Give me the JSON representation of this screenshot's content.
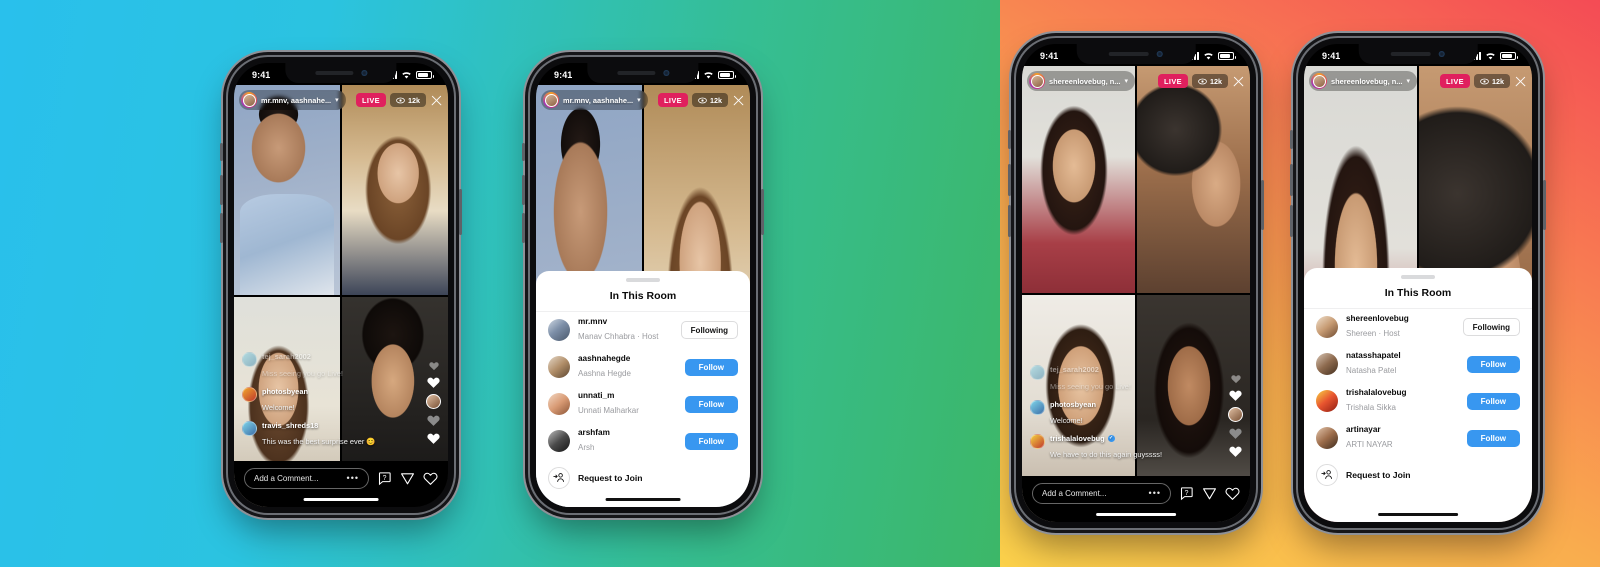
{
  "background": {
    "left_gradient": [
      "#29c0ec",
      "#3cb768"
    ],
    "right_gradient": [
      "#fbd14b",
      "#f44b55"
    ]
  },
  "status_bar": {
    "time": "9:41"
  },
  "phones": [
    {
      "id": "phone-1",
      "variant": "live-room-grid",
      "host_chip": {
        "names": "mr.mnv, aashnahe...",
        "avatar": "host-avatar"
      },
      "live_badge": "LIVE",
      "viewers": "12k",
      "close_label": "close-icon",
      "tiles": [
        "manav",
        "aashna",
        "girl1",
        "guy2"
      ],
      "comments": [
        {
          "user": "tej_sarah2002",
          "text": "Miss seeing you go Live!",
          "faded": true,
          "verified": false
        },
        {
          "user": "photosbyean",
          "text": "Welcome!",
          "faded": false,
          "verified": false
        },
        {
          "user": "travis_shreds18",
          "text": "This was the best surprise ever 😊",
          "faded": false,
          "verified": false
        }
      ],
      "comment_input": {
        "placeholder": "Add a Comment...",
        "more": "•••"
      },
      "actions": [
        "question-icon",
        "send-icon",
        "heart-icon"
      ]
    },
    {
      "id": "phone-2",
      "variant": "in-this-room-sheet",
      "host_chip": {
        "names": "mr.mnv, aashnahe...",
        "avatar": "host-avatar"
      },
      "live_badge": "LIVE",
      "viewers": "12k",
      "tiles": [
        "manav",
        "aashna"
      ],
      "sheet": {
        "title": "In This Room",
        "members": [
          {
            "username": "mr.mnv",
            "fullname": "Manav Chhabra · Host",
            "action": "Following",
            "state": "following",
            "avatar": "a1"
          },
          {
            "username": "aashnahegde",
            "fullname": "Aashna Hegde",
            "action": "Follow",
            "state": "follow",
            "avatar": "a2"
          },
          {
            "username": "unnati_m",
            "fullname": "Unnati Malharkar",
            "action": "Follow",
            "state": "follow",
            "avatar": "a3"
          },
          {
            "username": "arshfam",
            "fullname": "Arsh",
            "action": "Follow",
            "state": "follow",
            "avatar": "a4"
          }
        ],
        "request_to_join": "Request to Join"
      }
    },
    {
      "id": "phone-3",
      "variant": "live-room-grid",
      "host_chip": {
        "names": "shereenlovebug, n...",
        "avatar": "host-avatar"
      },
      "live_badge": "LIVE",
      "viewers": "12k",
      "close_label": "close-icon",
      "tiles": [
        "shereen",
        "makeup",
        "brush",
        "trish"
      ],
      "comments": [
        {
          "user": "tej_sarah2002",
          "text": "Miss seeing you go Live!",
          "faded": true,
          "verified": false
        },
        {
          "user": "photosbyean",
          "text": "Welcome!",
          "faded": false,
          "verified": false
        },
        {
          "user": "trishalalovebug",
          "text": "We have to do this again guyssss!",
          "faded": false,
          "verified": true
        }
      ],
      "comment_input": {
        "placeholder": "Add a Comment...",
        "more": "•••"
      },
      "actions": [
        "question-icon",
        "send-icon",
        "heart-icon"
      ]
    },
    {
      "id": "phone-4",
      "variant": "in-this-room-sheet",
      "host_chip": {
        "names": "shereenlovebug, n...",
        "avatar": "host-avatar"
      },
      "live_badge": "LIVE",
      "viewers": "12k",
      "tiles": [
        "shereen",
        "makeup"
      ],
      "sheet": {
        "title": "In This Room",
        "members": [
          {
            "username": "shereenlovebug",
            "fullname": "Shereen · Host",
            "action": "Following",
            "state": "following",
            "avatar": "b1"
          },
          {
            "username": "natasshapatel",
            "fullname": "Natasha Patel",
            "action": "Follow",
            "state": "follow",
            "avatar": "b2"
          },
          {
            "username": "trishalalovebug",
            "fullname": "Trishala Sikka",
            "action": "Follow",
            "state": "follow",
            "avatar": "b3"
          },
          {
            "username": "artinayar",
            "fullname": "ARTI NAYAR",
            "action": "Follow",
            "state": "follow",
            "avatar": "b4"
          }
        ],
        "request_to_join": "Request to Join"
      }
    }
  ],
  "colors": {
    "live_pink": "#e0205e",
    "follow_blue": "#3897f0",
    "verified_blue": "#3897f0"
  }
}
